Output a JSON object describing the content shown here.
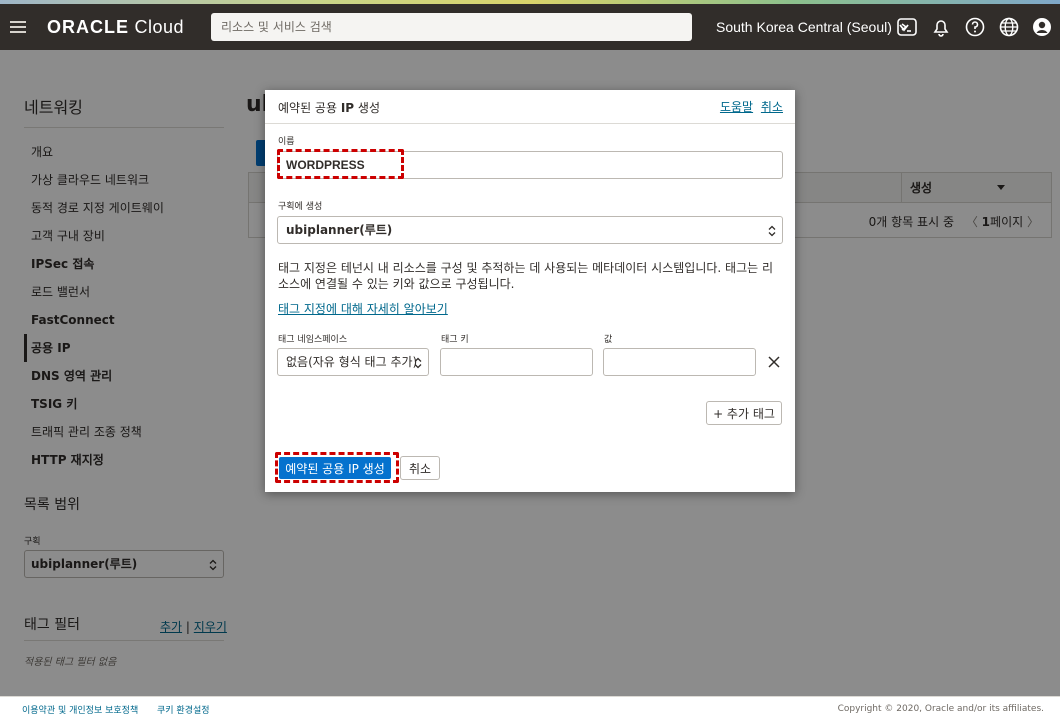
{
  "header": {
    "logo_bold": "ORACLE",
    "logo_light": " Cloud",
    "search_placeholder": "리소스 및 서비스 검색",
    "region": "South Korea Central (Seoul)"
  },
  "sidebar": {
    "title": "네트워킹",
    "items": [
      {
        "label": "개요"
      },
      {
        "label": "가상 클라우드 네트워크"
      },
      {
        "label": "동적 경로 지정 게이트웨이"
      },
      {
        "label": "고객 구내 장비"
      },
      {
        "label": "IPSec 접속"
      },
      {
        "label": "로드 밸런서"
      },
      {
        "label": "FastConnect"
      },
      {
        "label": "공용 IP"
      },
      {
        "label": "DNS 영역 관리"
      },
      {
        "label": "TSIG 키"
      },
      {
        "label": "트래픽 관리 조종 정책"
      },
      {
        "label": "HTTP 재지정"
      }
    ],
    "scope_title": "목록 범위",
    "compartment_label": "구획",
    "compartment_value": "ubiplanner(루트)",
    "tag_filter_title": "태그 필터",
    "tag_filter_add": "추가",
    "tag_filter_sep": "|",
    "tag_filter_clear": "지우기",
    "tag_filter_empty": "적용된 태그 필터 없음"
  },
  "main": {
    "title_partial": "ul",
    "column_created": "생성",
    "pager_count": "0개 항목 표시 중",
    "pager_prev": "〈",
    "pager_page": "1",
    "pager_page_suffix": "페이지",
    "pager_next": "〉"
  },
  "modal": {
    "title_prefix": "예약된 공용 ",
    "title_ip": "IP",
    "title_suffix": " 생성",
    "help_link": "도움말",
    "cancel_link": "취소",
    "name_label": "이름",
    "name_value": "WORDPRESS",
    "compartment_label": "구획에 생성",
    "compartment_value": "ubiplanner(루트)",
    "tag_description": "태그 지정은 테넌시 내 리소스를 구성 및 추적하는 데 사용되는 메타데이터 시스템입니다. 태그는 리소스에 연결될 수 있는 키와 값으로 구성됩니다.",
    "tag_learn_link": "태그 지정에 대해 자세히 알아보기",
    "tag_namespace_label": "태그 네임스페이스",
    "tag_namespace_value": "없음(자유 형식 태그 추가)",
    "tag_key_label": "태그 키",
    "tag_value_label": "값",
    "add_tag_button": "+ 추가 태그",
    "create_button": "예약된 공용 IP 생성",
    "cancel_button": "취소"
  },
  "footer": {
    "terms_link": "이용약관 및 개인정보 보호정책",
    "cookie_link": "쿠키 환경설정",
    "copyright": "Copyright © 2020, Oracle and/or its affiliates."
  },
  "colors": {
    "header_bg": "#312d2a",
    "primary_button": "#0572ce",
    "link": "#00688c",
    "highlight": "#cc0000"
  }
}
